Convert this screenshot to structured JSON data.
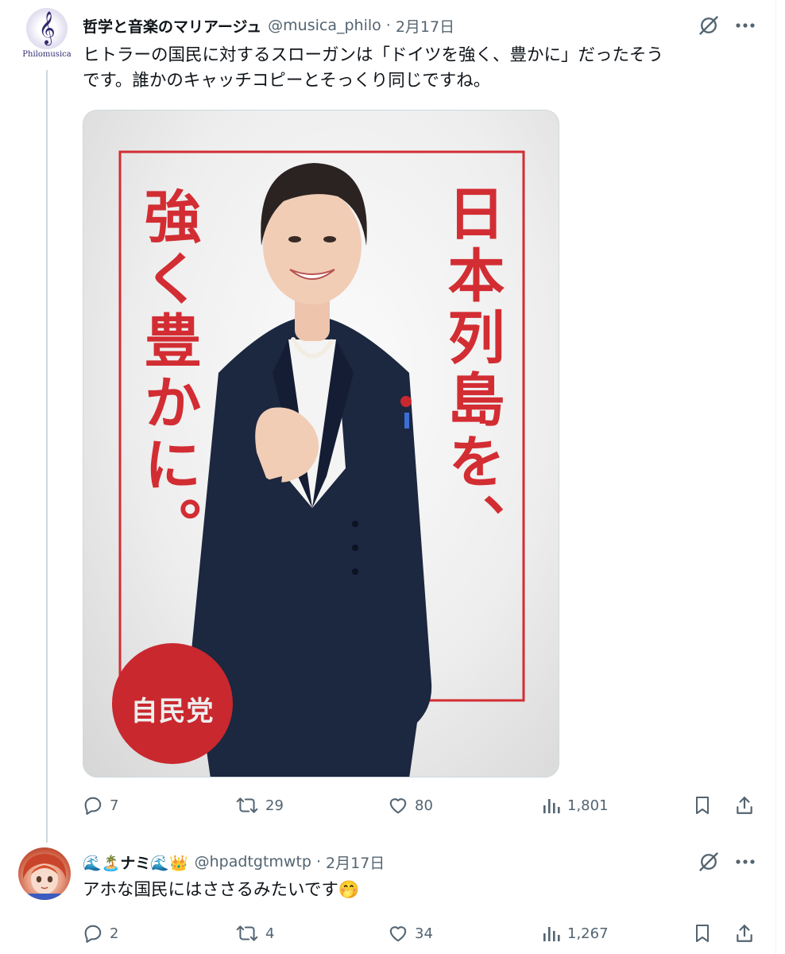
{
  "tweet": {
    "author_name": "哲学と音楽のマリアージュ",
    "handle": "@musica_philo",
    "date": "2月17日",
    "avatar_brand": "Philomusica",
    "avatar_icon": "treble-clef-logo",
    "text_lines": [
      "ヒトラーの国民に対するスローガンは「ドイツを強く、豊かに」だったそう",
      "です。誰かのキャッチコピーとそっくり同じですね。"
    ],
    "image": {
      "slogan_right": "日本列島を、",
      "slogan_left": "強く豊かに。",
      "party_badge": "自民党",
      "accent_color": "#d22d33"
    },
    "stats": {
      "replies": "7",
      "reposts": "29",
      "likes": "80",
      "views": "1,801"
    }
  },
  "reply": {
    "author_name": "🌊🏝️ナミ🌊👑",
    "handle": "@hpadtgtmwtp",
    "date": "2月17日",
    "text": "アホな国民にはささるみたいです🤭",
    "stats": {
      "replies": "2",
      "reposts": "4",
      "likes": "34",
      "views": "1,267"
    }
  },
  "separator": "·",
  "colors": {
    "text_primary": "#0f1419",
    "text_secondary": "#536471",
    "thread_line": "#cfd9de"
  }
}
